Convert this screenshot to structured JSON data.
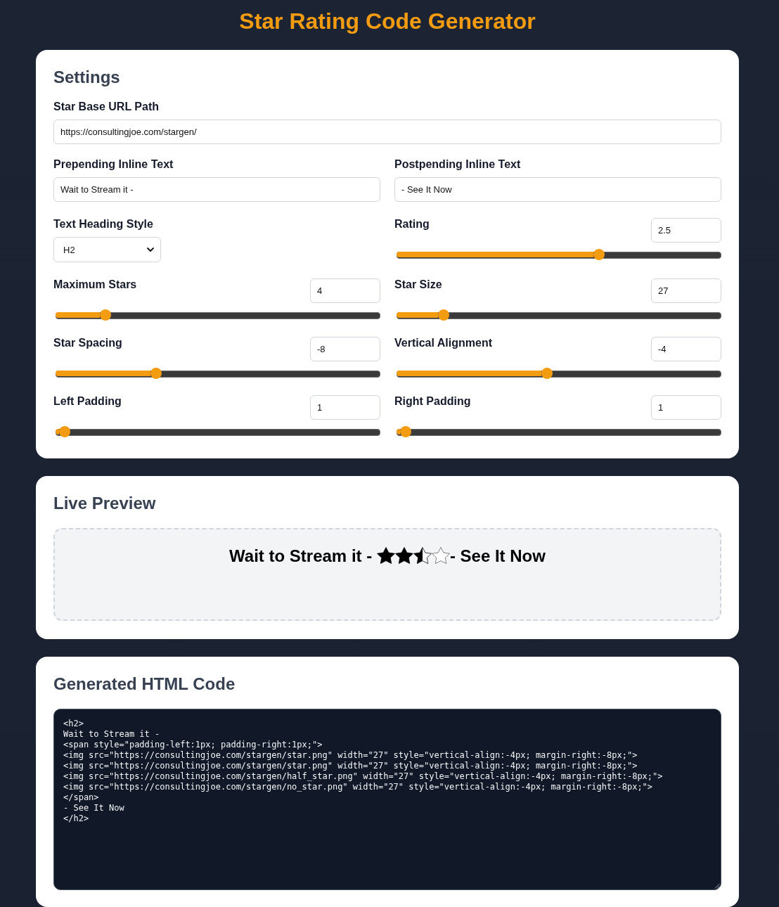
{
  "title": "Star Rating Code Generator",
  "settings": {
    "heading": "Settings",
    "base_url": {
      "label": "Star Base URL Path",
      "value": "https://consultingjoe.com/stargen/"
    },
    "fields": [
      {
        "kind": "text",
        "label": "Prepending Inline Text",
        "value": "Wait to Stream it -"
      },
      {
        "kind": "text",
        "label": "Postpending Inline Text",
        "value": "- See It Now"
      },
      {
        "kind": "select",
        "label": "Text Heading Style",
        "value": "H2"
      },
      {
        "kind": "range",
        "label": "Rating",
        "value": "2.5",
        "level": 0.625
      },
      {
        "kind": "range",
        "label": "Maximum Stars",
        "value": "4",
        "level": 0.14
      },
      {
        "kind": "range",
        "label": "Star Size",
        "value": "27",
        "level": 0.13
      },
      {
        "kind": "range",
        "label": "Star Spacing",
        "value": "-8",
        "level": 0.3
      },
      {
        "kind": "range",
        "label": "Vertical Alignment",
        "value": "-4",
        "level": 0.46
      },
      {
        "kind": "range",
        "label": "Left Padding",
        "value": "1",
        "level": 0.01
      },
      {
        "kind": "range",
        "label": "Right Padding",
        "value": "1",
        "level": 0.01
      }
    ]
  },
  "preview": {
    "heading": "Live Preview",
    "prefix": "Wait to Stream it -",
    "stars": [
      {
        "kind": "full"
      },
      {
        "kind": "full"
      },
      {
        "kind": "half"
      },
      {
        "kind": "empty"
      }
    ],
    "suffix": "- See It Now"
  },
  "code": {
    "heading": "Generated HTML Code",
    "lines": [
      "<h2>",
      "Wait to Stream it -",
      "<span style=\"padding-left:1px; padding-right:1px;\">",
      "<img src=\"https://consultingjoe.com/stargen/star.png\" width=\"27\" style=\"vertical-align:-4px; margin-right:-8px;\">",
      "<img src=\"https://consultingjoe.com/stargen/star.png\" width=\"27\" style=\"vertical-align:-4px; margin-right:-8px;\">",
      "<img src=\"https://consultingjoe.com/stargen/half_star.png\" width=\"27\" style=\"vertical-align:-4px; margin-right:-8px;\">",
      "<img src=\"https://consultingjoe.com/stargen/no_star.png\" width=\"27\" style=\"vertical-align:-4px; margin-right:-8px;\">",
      "</span>",
      "- See It Now",
      "</h2>"
    ]
  }
}
